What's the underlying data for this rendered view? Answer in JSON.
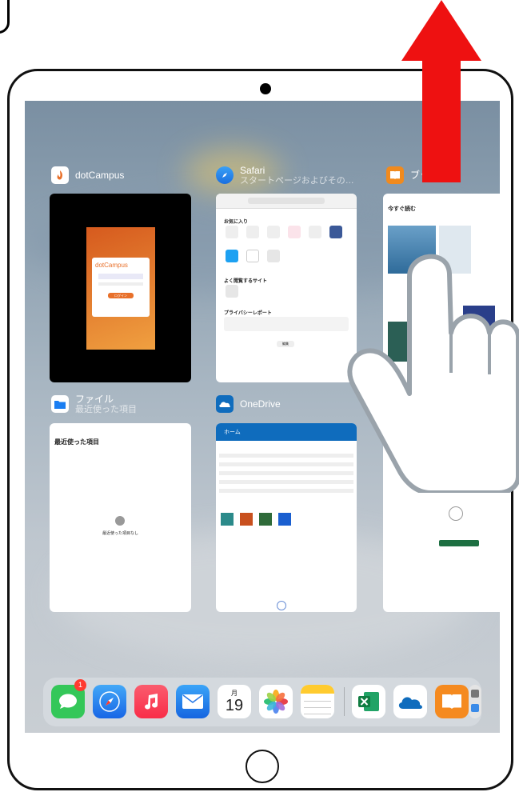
{
  "cards": {
    "dotcampus": {
      "title": "dotCampus",
      "logo_text": "dotCampus",
      "login_button": "ログイン"
    },
    "safari": {
      "title": "Safari",
      "subtitle": "スタートページおよびその…",
      "favorites_heading": "お気に入り",
      "frequent_heading": "よく閲覧するサイト",
      "privacy_heading": "プライバシーレポート",
      "edit_button": "編集"
    },
    "books": {
      "title": "ブック",
      "read_now": "今すぐ読む"
    },
    "files": {
      "title": "ファイル",
      "subtitle": "最近使った項目",
      "heading": "最近使った項目",
      "empty_text": "最近使った項目なし"
    },
    "onedrive": {
      "title": "OneDrive",
      "home": "ホーム"
    }
  },
  "dock": {
    "apps": [
      "messages-icon",
      "safari-icon",
      "music-icon",
      "mail-icon",
      "calendar-icon",
      "photos-icon",
      "notes-icon",
      "excel-icon",
      "onedrive-icon",
      "books-icon",
      "utilities-icon"
    ],
    "messages_badge": "1",
    "calendar_weekday": "月",
    "calendar_day": "19"
  },
  "colors": {
    "arrow": "#ee1111",
    "dotcampus_orange": "#e8702a",
    "onedrive_blue": "#0f6cbd",
    "excel_green": "#1d6f42"
  }
}
